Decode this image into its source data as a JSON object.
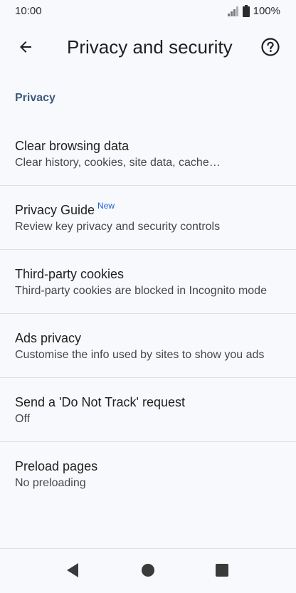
{
  "status_bar": {
    "time": "10:00",
    "battery": "100%",
    "icons": [
      "signal-icon",
      "battery-icon"
    ]
  },
  "app_bar": {
    "title": "Privacy and security",
    "back_icon": "arrow-back-icon",
    "help_icon": "help-circle-icon"
  },
  "section": {
    "header": "Privacy"
  },
  "items": [
    {
      "title": "Clear browsing data",
      "badge": "",
      "summary": "Clear history, cookies, site data, cache…"
    },
    {
      "title": "Privacy Guide",
      "badge": "New",
      "summary": "Review key privacy and security controls"
    },
    {
      "title": "Third-party cookies",
      "badge": "",
      "summary": "Third-party cookies are blocked in Incognito mode"
    },
    {
      "title": "Ads privacy",
      "badge": "",
      "summary": "Customise the info used by sites to show you ads"
    },
    {
      "title": "Send a 'Do Not Track' request",
      "badge": "",
      "summary": "Off"
    },
    {
      "title": "Preload pages",
      "badge": "",
      "summary": "No preloading"
    }
  ],
  "nav_bar": {
    "icons": [
      "nav-back-icon",
      "nav-home-icon",
      "nav-recents-icon"
    ]
  },
  "colors": {
    "background": "#f8f9fc",
    "section_header": "#3d5a80",
    "badge": "#1a5fd0",
    "divider": "#dcdfe4"
  }
}
